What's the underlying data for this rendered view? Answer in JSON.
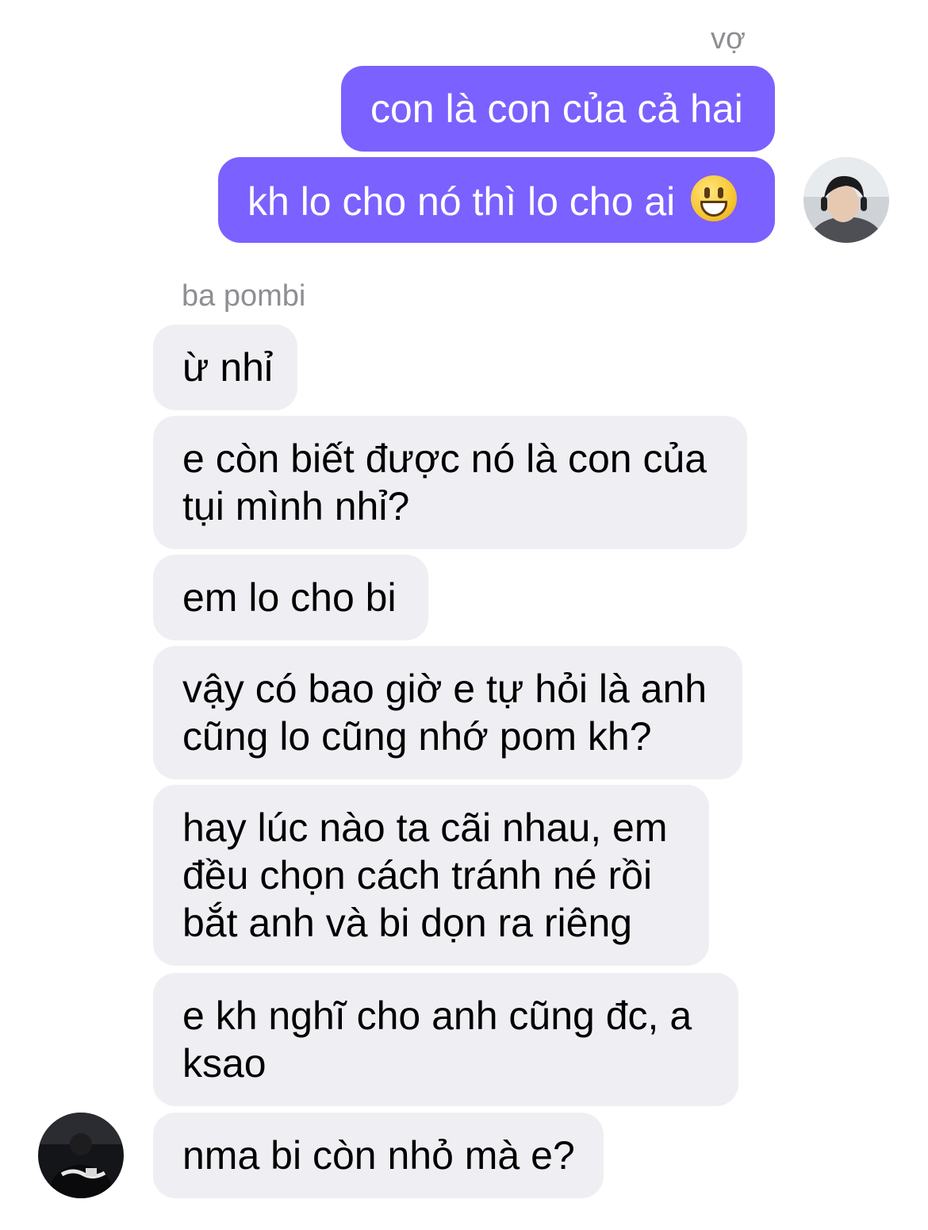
{
  "conversation": {
    "outgoing_sender": "vợ",
    "incoming_sender": "ba pombi",
    "outgoing": [
      {
        "lines": [
          "con là con của cả hai"
        ]
      },
      {
        "lines": [
          "kh lo cho nó thì lo cho ai"
        ],
        "emoji": "grinning-face-emoji"
      }
    ],
    "incoming": [
      {
        "lines": [
          "ừ nhỉ"
        ]
      },
      {
        "lines": [
          "e còn biết được nó là con của",
          "tụi mình nhỉ?"
        ]
      },
      {
        "lines": [
          "em lo cho bi"
        ]
      },
      {
        "lines": [
          "vậy có bao giờ e tự hỏi là anh",
          "cũng lo cũng nhớ pom kh?"
        ]
      },
      {
        "lines": [
          "hay lúc nào ta cãi nhau, em",
          "đều chọn cách tránh né rồi",
          "bắt anh và bi dọn ra riêng"
        ]
      },
      {
        "lines": [
          "e kh nghĩ cho anh cũng đc, a",
          "ksao"
        ]
      },
      {
        "lines": [
          "nma bi còn nhỏ mà e?"
        ]
      }
    ]
  },
  "colors": {
    "outgoing_bubble": "#7b61ff",
    "incoming_bubble": "#efeff3",
    "sender_label": "#8e8e93"
  }
}
